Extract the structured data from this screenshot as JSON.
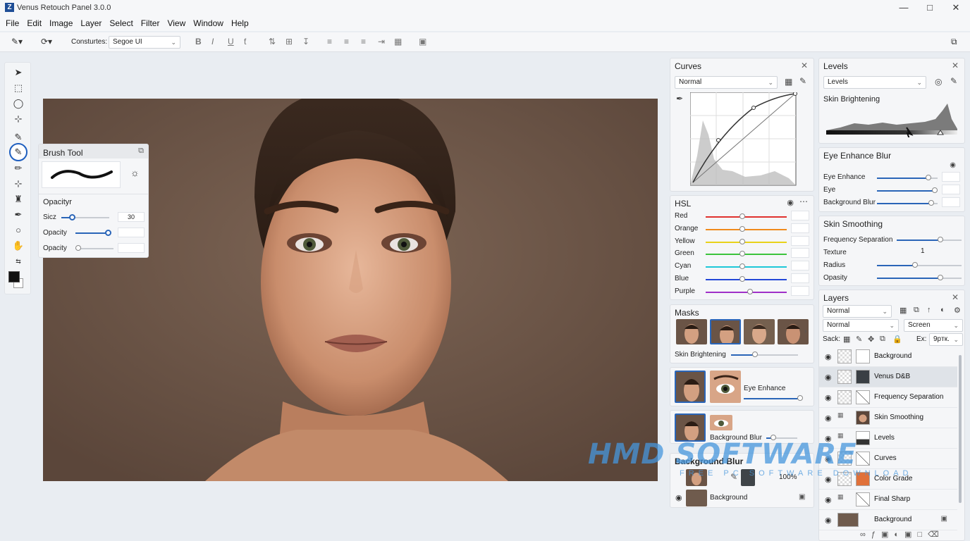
{
  "app": {
    "title": "Venus Retouch Panel 3.0.0",
    "logo_icon": "z-logo-icon"
  },
  "menu": [
    "File",
    "Edit",
    "Image",
    "Layer",
    "Select",
    "Filter",
    "View",
    "Window",
    "Help"
  ],
  "toolbar": {
    "font_label": "Consturtes:",
    "font_value": "Segoe UI"
  },
  "brush_popup": {
    "title": "Brush Tool",
    "section": "Opacityr",
    "rows": [
      {
        "label": "Sicz",
        "value": "30"
      },
      {
        "label": "Opacity",
        "value": ""
      },
      {
        "label": "Opacity",
        "value": ""
      }
    ]
  },
  "curves": {
    "title": "Curves",
    "mode": "Normal"
  },
  "hsl": {
    "title": "HSL",
    "rows": [
      {
        "label": "Red",
        "color": "#e0322e"
      },
      {
        "label": "Orange",
        "color": "#f08a1c"
      },
      {
        "label": "Yellow",
        "color": "#e8d21a"
      },
      {
        "label": "Green",
        "color": "#3cc43c"
      },
      {
        "label": "Cyan",
        "color": "#1ec8d8"
      },
      {
        "label": "Blue",
        "color": "#2347d8"
      },
      {
        "label": "Purple",
        "color": "#a030c8"
      }
    ]
  },
  "masks": {
    "title": "Masks",
    "slider_label": "Skin Brightening"
  },
  "eye_enhance_card": {
    "label": "Eye Enhance"
  },
  "bg_blur_card": {
    "label": "Background Blur"
  },
  "bg_blur_section": {
    "title": "Background Blur",
    "percent": "100%",
    "layer": "Background"
  },
  "levels": {
    "title": "Levels",
    "dropdown": "Levels",
    "subtitle": "Skin Brightening"
  },
  "eye_blur": {
    "title": "Eye Enhance Blur",
    "rows": [
      {
        "label": "Eye Enhance",
        "level": 0.85
      },
      {
        "label": "Eye",
        "level": 0.95
      },
      {
        "label": "Background Blur",
        "level": 0.9
      }
    ]
  },
  "skin_smoothing": {
    "title": "Skin Smoothing",
    "rows": [
      {
        "label": "Frequency Separation",
        "value": ""
      },
      {
        "label": "Texture",
        "value": "1"
      },
      {
        "label": "Radius",
        "value": ""
      },
      {
        "label": "Opasity",
        "value": ""
      }
    ]
  },
  "layers": {
    "title": "Layers",
    "blend1": "Normal",
    "blend2": "Normal",
    "blend3": "Screen",
    "sack_label": "Sack:",
    "ex_label": "Ex:",
    "ex_value": "9pтк.",
    "items": [
      {
        "name": "Background"
      },
      {
        "name": "Venus D&B"
      },
      {
        "name": "Frequency Separation"
      },
      {
        "name": "Skin Smoothing"
      },
      {
        "name": "Levels"
      },
      {
        "name": "Curves"
      },
      {
        "name": "Color Grade"
      },
      {
        "name": "Final Sharp"
      },
      {
        "name": "Background"
      }
    ]
  },
  "watermark": {
    "main": "HMD SOFTWARE",
    "sub": "FREE PC SOFTWARE DOWNLOAD"
  }
}
